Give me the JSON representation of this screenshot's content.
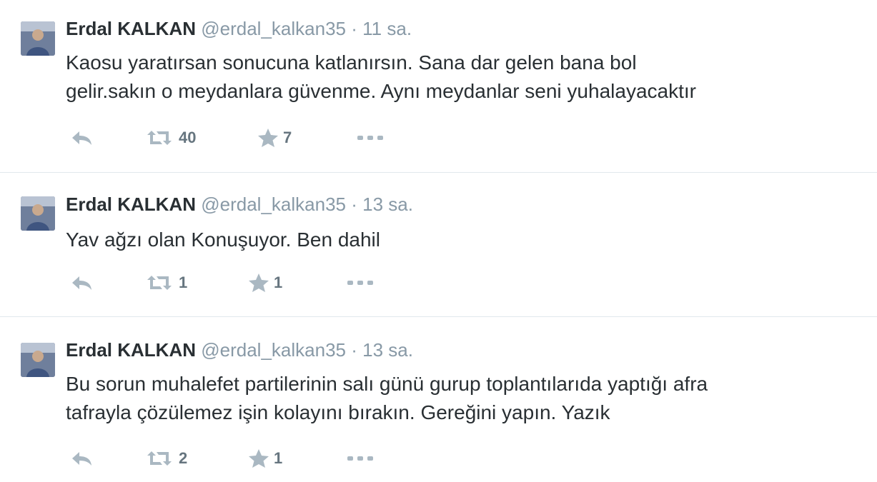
{
  "tweets": [
    {
      "fullname": "Erdal KALKAN",
      "username": "@erdal_kalkan35",
      "separator": "·",
      "time": "11 sa.",
      "text_lines": [
        "Kaosu yaratırsan sonucuna katlanırsın. Sana dar gelen bana bol",
        "gelir.sakın o meydanlara güvenme. Aynı meydanlar seni yuhalayacaktır"
      ],
      "retweets": "40",
      "favorites": "7"
    },
    {
      "fullname": "Erdal KALKAN",
      "username": "@erdal_kalkan35",
      "separator": "·",
      "time": "13 sa.",
      "text_lines": [
        "Yav ağzı olan Konuşuyor. Ben dahil"
      ],
      "retweets": "1",
      "favorites": "1"
    },
    {
      "fullname": "Erdal KALKAN",
      "username": "@erdal_kalkan35",
      "separator": "·",
      "time": "13 sa.",
      "text_lines": [
        "Bu sorun muhalefet partilerinin salı günü gurup toplantılarıda yaptığı afra",
        "tafrayla çözülemez işin kolayını bırakın. Gereğini yapın. Yazık"
      ],
      "retweets": "2",
      "favorites": "1"
    }
  ],
  "icons": {
    "reply": "reply-icon",
    "retweet": "retweet-icon",
    "favorite": "star-icon",
    "more": "more-icon"
  },
  "colors": {
    "text": "#292f33",
    "muted": "#8899a6",
    "divider": "#e1e8ed"
  }
}
